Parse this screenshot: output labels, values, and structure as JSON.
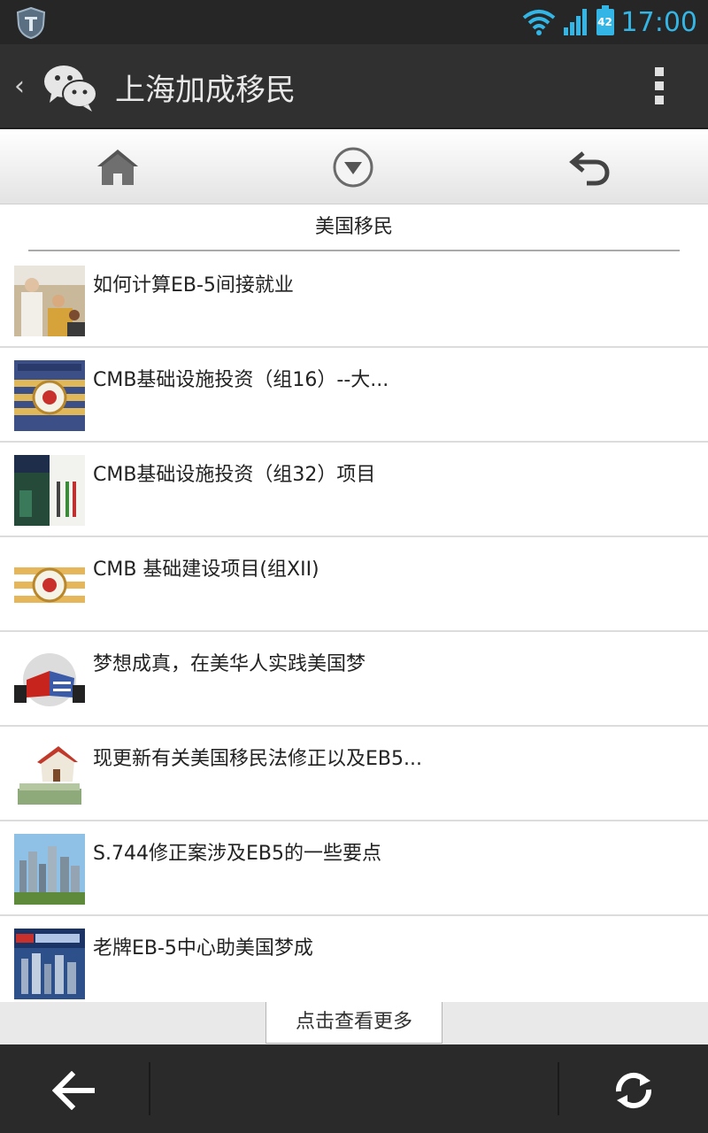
{
  "status_bar": {
    "time": "17:00",
    "battery": "42",
    "icons": [
      "shield-icon",
      "wifi-icon",
      "signal-icon",
      "battery-icon"
    ]
  },
  "action_bar": {
    "title": "上海加成移民",
    "back_icon": "chevron-left-icon",
    "logo": "wechat-logo-icon",
    "menu_icon": "overflow-menu-icon"
  },
  "toolbar": {
    "home_icon": "home-icon",
    "dropdown_icon": "dropdown-circle-icon",
    "return_icon": "undo-arrow-icon"
  },
  "section": {
    "title": "美国移民"
  },
  "articles": [
    {
      "title": "如何计算EB-5间接就业"
    },
    {
      "title": "CMB基础设施投资（组16）--大..."
    },
    {
      "title": "CMB基础设施投资（组32）项目"
    },
    {
      "title": "CMB 基础建设项目(组XII)"
    },
    {
      "title": "梦想成真，在美华人实践美国梦"
    },
    {
      "title": "现更新有关美国移民法修正以及EB5..."
    },
    {
      "title": "S.744修正案涉及EB5的一些要点"
    },
    {
      "title": "老牌EB-5中心助美国梦成"
    }
  ],
  "load_more": {
    "label": "点击查看更多"
  },
  "bottom_bar": {
    "back_icon": "arrow-left-icon",
    "refresh_icon": "refresh-icon"
  },
  "colors": {
    "accent": "#33b5e5",
    "action_bar": "#303030",
    "bottom_bar": "#2a2a2a"
  }
}
